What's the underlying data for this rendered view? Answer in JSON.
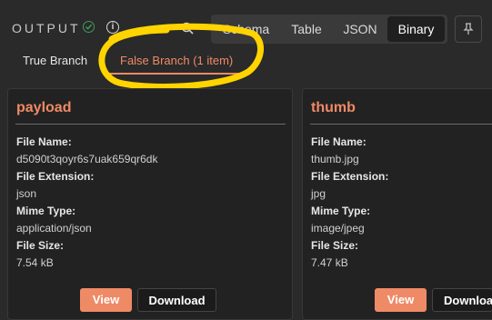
{
  "header": {
    "title": "OUTPUT",
    "tabs": [
      "Schema",
      "Table",
      "JSON",
      "Binary"
    ],
    "active_tab": "Binary"
  },
  "branches": {
    "true_label": "True Branch",
    "false_label": "False Branch (1 item)",
    "active": "False Branch (1 item)"
  },
  "cards": [
    {
      "title": "payload",
      "file_name_label": "File Name:",
      "file_name": "d5090t3qoyr6s7uak659qr6dk",
      "file_ext_label": "File Extension:",
      "file_ext": "json",
      "mime_label": "Mime Type:",
      "mime": "application/json",
      "size_label": "File Size:",
      "size": "7.54 kB",
      "view": "View",
      "download": "Download"
    },
    {
      "title": "thumb",
      "file_name_label": "File Name:",
      "file_name": "thumb.jpg",
      "file_ext_label": "File Extension:",
      "file_ext": "jpg",
      "mime_label": "Mime Type:",
      "mime": "image/jpeg",
      "size_label": "File Size:",
      "size": "7.47 kB",
      "view": "View",
      "download": "Downloa"
    }
  ],
  "colors": {
    "accent": "#ef8a66",
    "background": "#2a2a2a",
    "highlight_annotation": "#ffd400",
    "success": "#3e9b5a"
  },
  "icons": [
    "check-circle-icon",
    "info-icon",
    "search-icon",
    "pin-icon"
  ]
}
